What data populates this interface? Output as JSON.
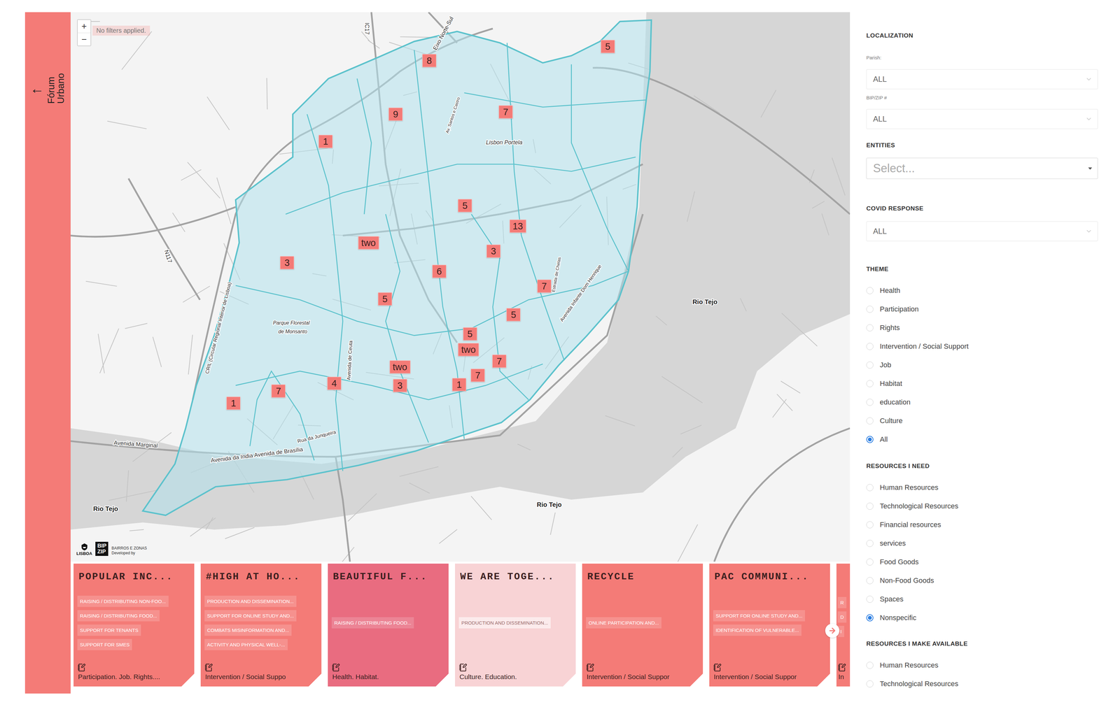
{
  "sidebar": {
    "back": "←",
    "title_lines": [
      "Fórum",
      "Urbano"
    ]
  },
  "map": {
    "notice": "No filters applied.",
    "zoom": [
      "+",
      "−"
    ],
    "labels": [
      "Eixo Norte-Sul",
      "IC17",
      "N117",
      "Av. Santos e Castro",
      "Lisbon Portela",
      "CRIL (Circular Regional Interior de Lisboa)",
      "Parque Florestal",
      "de Monsanto",
      "Avenida de Ceuta",
      "Rua da Junqueira",
      "Avenida Marginal",
      "Avenida da India Avenida de Brasília",
      "Estrada de Chelas",
      "Avenida Infante Dom Henrique"
    ],
    "water_labels": [
      "Rio Tejo",
      "Rio Tejo",
      "Rio Tejo"
    ],
    "pins": [
      {
        "label": "5"
      },
      {
        "label": "8"
      },
      {
        "label": "9"
      },
      {
        "label": "7"
      },
      {
        "label": "1"
      },
      {
        "label": "5"
      },
      {
        "label": "13"
      },
      {
        "label": "two"
      },
      {
        "label": "3"
      },
      {
        "label": "3"
      },
      {
        "label": "6"
      },
      {
        "label": "7"
      },
      {
        "label": "5"
      },
      {
        "label": "5"
      },
      {
        "label": "5"
      },
      {
        "label": "two"
      },
      {
        "label": "7"
      },
      {
        "label": "two"
      },
      {
        "label": "7"
      },
      {
        "label": "3"
      },
      {
        "label": "1"
      },
      {
        "label": "4"
      },
      {
        "label": "7"
      },
      {
        "label": "1"
      }
    ],
    "logo": {
      "city": "LISBOA",
      "mark": [
        "BIP",
        "ZIP"
      ],
      "caption": "BAIRROS E ZONAS",
      "credit": "Developed by"
    }
  },
  "cards": [
    {
      "title": "POPULAR INC...",
      "tags": [
        "RAISING / DISTRIBUTING NON-FOO...",
        "RAISING / DISTRIBUTING FOOD...",
        "SUPPORT FOR TENANTS",
        "SUPPORT FOR SMES"
      ],
      "footer": "Participation. Job. Rights....",
      "color": "#f47b77",
      "kind": "full"
    },
    {
      "title": "#HIGH AT HO...",
      "tags": [
        "PRODUCTION AND DISSEMINATION...",
        "SUPPORT FOR ONLINE STUDY AND...",
        "COMBATS MISINFORMATION AND...",
        "ACTIVITY AND PHYSICAL WELL-..."
      ],
      "footer": "Intervention / Social Suppo",
      "color": "#f47b77",
      "kind": "full"
    },
    {
      "title": "BEAUTIFUL F...",
      "tags": [
        "RAISING / DISTRIBUTING FOOD..."
      ],
      "footer": "Health. Habitat.",
      "color": "#e96c80",
      "kind": "full"
    },
    {
      "title": "WE ARE TOGE...",
      "tags": [
        "PRODUCTION AND DISSEMINATION..."
      ],
      "footer": "Culture. Education.",
      "color": "#f8d3d5",
      "kind": "full"
    },
    {
      "title": "RECYCLE",
      "tags": [
        "ONLINE PARTICIPATION AND..."
      ],
      "footer": "Intervention / Social Suppor",
      "color": "#f47b77",
      "kind": "full"
    },
    {
      "title": "PAC COMMUNI...",
      "tags": [
        "SUPPORT FOR ONLINE STUDY AND...",
        "IDENTIFICATION OF VULNERABLE..."
      ],
      "footer": "Intervention / Social Suppor",
      "color": "#f47b77",
      "kind": "full"
    },
    {
      "tags": [
        "R",
        "D",
        "I"
      ],
      "footer": "In",
      "color": "#f47b77",
      "kind": "partial"
    }
  ],
  "filters": {
    "localization": {
      "heading": "LOCALIZATION",
      "fields": [
        {
          "label": "Parish:",
          "value": "ALL"
        },
        {
          "label": "BIP/ZIP #",
          "value": "ALL"
        }
      ]
    },
    "entities": {
      "heading": "ENTITIES",
      "placeholder": "Select..."
    },
    "covid": {
      "heading": "COVID RESPONSE",
      "value": "ALL"
    },
    "groups": [
      {
        "heading": "THEME",
        "options": [
          {
            "label": "Health",
            "selected": false
          },
          {
            "label": "Participation",
            "selected": false
          },
          {
            "label": "Rights",
            "selected": false
          },
          {
            "label": "Intervention / Social Support",
            "selected": false
          },
          {
            "label": "Job",
            "selected": false
          },
          {
            "label": "Habitat",
            "selected": false
          },
          {
            "label": "education",
            "selected": false
          },
          {
            "label": "Culture",
            "selected": false
          },
          {
            "label": "All",
            "selected": true
          }
        ]
      },
      {
        "heading": "RESOURCES I NEED",
        "options": [
          {
            "label": "Human Resources",
            "selected": false
          },
          {
            "label": "Technological Resources",
            "selected": false
          },
          {
            "label": "Financial resources",
            "selected": false
          },
          {
            "label": "services",
            "selected": false
          },
          {
            "label": "Food Goods",
            "selected": false
          },
          {
            "label": "Non-Food Goods",
            "selected": false
          },
          {
            "label": "Spaces",
            "selected": false
          },
          {
            "label": "Nonspecific",
            "selected": true
          }
        ]
      },
      {
        "heading": "RESOURCES I MAKE AVAILABLE",
        "options": [
          {
            "label": "Human Resources",
            "selected": false
          },
          {
            "label": "Technological Resources",
            "selected": false
          }
        ]
      }
    ]
  }
}
